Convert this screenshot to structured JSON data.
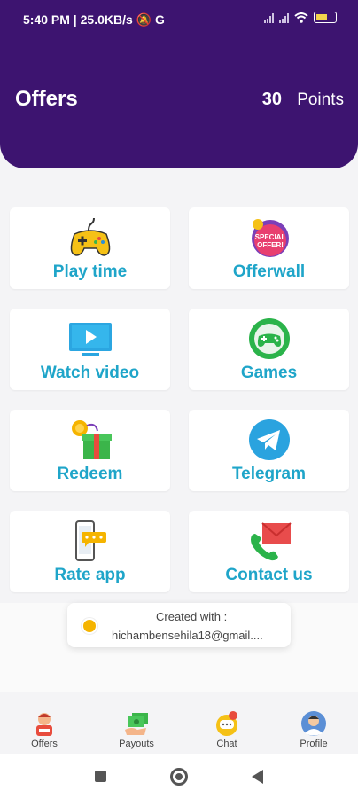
{
  "status": {
    "time": "5:40 PM",
    "speed": "25.0KB/s"
  },
  "header": {
    "title": "Offers",
    "points_value": "30",
    "points_label": "Points"
  },
  "cards": [
    {
      "label": "Play time",
      "icon": "gamepad-icon"
    },
    {
      "label": "Offerwall",
      "icon": "special-offer-icon"
    },
    {
      "label": "Watch video",
      "icon": "video-icon"
    },
    {
      "label": "Games",
      "icon": "game-controller-icon"
    },
    {
      "label": "Redeem",
      "icon": "gift-icon"
    },
    {
      "label": "Telegram",
      "icon": "telegram-icon"
    },
    {
      "label": "Rate app",
      "icon": "phone-rating-icon"
    },
    {
      "label": "Contact us",
      "icon": "contact-icon"
    }
  ],
  "toast": {
    "line1": "Created with :",
    "line2": "hichambensehila18@gmail...."
  },
  "nav": [
    {
      "label": "Offers"
    },
    {
      "label": "Payouts"
    },
    {
      "label": "Chat"
    },
    {
      "label": "Profile"
    }
  ],
  "colors": {
    "header": "#3d1470",
    "label": "#1fa5c9"
  }
}
